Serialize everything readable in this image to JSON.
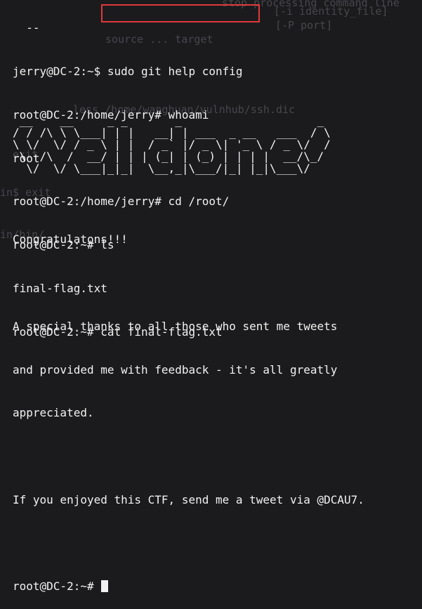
{
  "ghost_text": {
    "stop_processing": "stop processing command line",
    "identity_file": "[-i identity_file]",
    "port": "[-P port]",
    "source_target": "source ... target",
    "less_path": "less /home/wanghuan/vulnhub/ssh.dic",
    "exit": "exit",
    "bin": "in$ exit",
    "bin2": "in/bin/"
  },
  "terminal": {
    "line_0": "  --",
    "prompt_user": "jerry@DC-2:~$ ",
    "highlight_cmd": "sudo git help config",
    "line_2": "root@DC-2:/home/jerry# whoami",
    "line_3": "root",
    "line_4": "root@DC-2:/home/jerry# cd /root/",
    "line_5": "root@DC-2:~# ls",
    "line_6": "final-flag.txt",
    "line_7": "root@DC-2:~# cat final-flag.txt",
    "ascii_art": " __    __     _ _       _                    _ \n/ / /\\ \\ \\___| | |   __| | ___  _ __   ___  / \\\n\\ \\/  \\/ / _ \\ | |  / _` |/ _ \\| '_ \\ / _ \\/  /\n \\  /\\  /  __/ | | | (_| | (_) | | | |  __/\\_/ \n  \\/  \\/ \\___|_|_|  \\__,_|\\___/|_| |_|\\___\\/   ",
    "congrats": "Congratulatons!!!",
    "thanks_1": "A special thanks to all those who sent me tweets",
    "thanks_2": "and provided me with feedback - it's all greatly",
    "thanks_3": "appreciated.",
    "tweet": "If you enjoyed this CTF, send me a tweet via @DCAU7.",
    "final_prompt": "root@DC-2:~# "
  },
  "colors": {
    "background": "#1b1b1e",
    "text": "#f2f2f2",
    "highlight_border": "#e0383b",
    "ghost": "#47474c"
  }
}
